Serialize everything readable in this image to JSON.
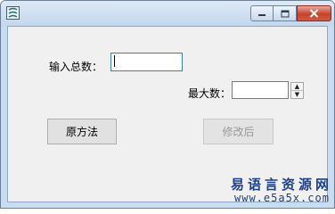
{
  "window": {
    "icon": "app-icon",
    "controls": {
      "minimize": "minimize-icon",
      "maximize": "maximize-icon",
      "close": "close-icon"
    }
  },
  "form": {
    "total_label": "输入总数：",
    "total_value": "",
    "max_label": "最大数：",
    "max_value": "",
    "original_button": "原方法",
    "modified_button": "修改后"
  },
  "watermark": {
    "line1": "易语言资源网",
    "line2": "www.e5a5x.com"
  }
}
